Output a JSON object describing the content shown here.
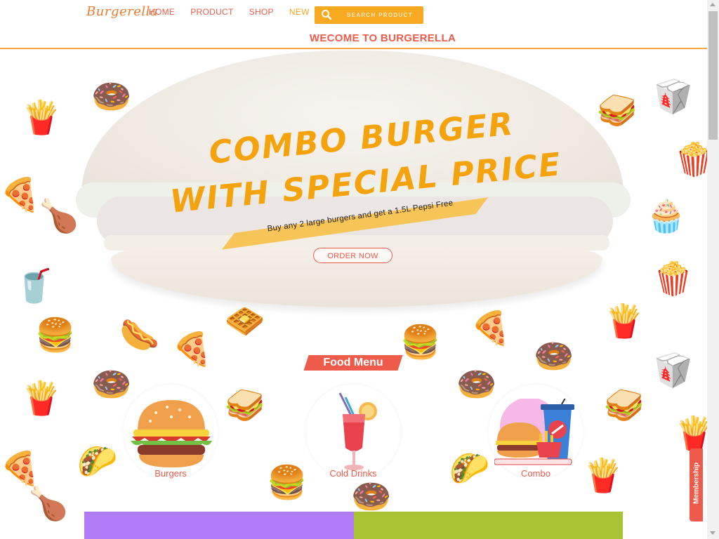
{
  "brand": {
    "logo": "Burgerella",
    "accent": "#ef5b4b",
    "secondary": "#f9a91f"
  },
  "nav": {
    "items": [
      "HOME",
      "PRODUCT",
      "SHOP",
      "NEW"
    ]
  },
  "search": {
    "placeholder": "SEARCH PRODUCT",
    "icon": "search-icon"
  },
  "welcome": "WECOME TO BURGERELLA",
  "hero": {
    "line1": "COMBO BURGER",
    "line2": "WITH SPECIAL PRICE",
    "tagline": "Buy any 2 large burgers and get a 1.5L Pepsi Free",
    "button": "ORDER NOW"
  },
  "menu": {
    "title": "Food Menu",
    "categories": [
      {
        "label": "Burgers",
        "icon": "burger-icon"
      },
      {
        "label": "Cold Drinks",
        "icon": "cocktail-icon"
      },
      {
        "label": "Combo",
        "icon": "combo-meal-icon"
      }
    ]
  },
  "membership": {
    "label": "Membership"
  }
}
